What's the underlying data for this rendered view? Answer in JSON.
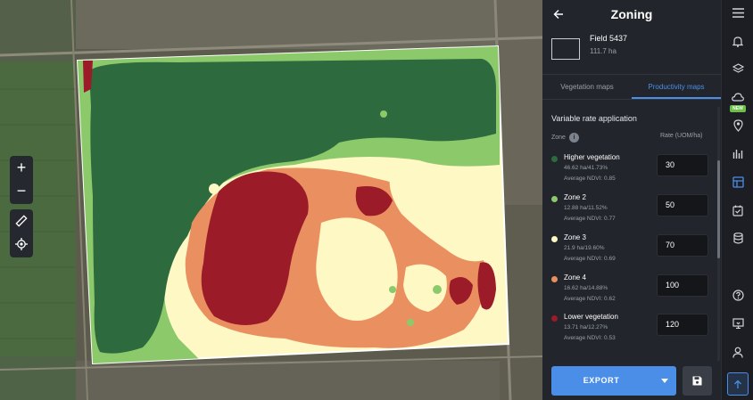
{
  "header": {
    "title": "Zoning"
  },
  "field": {
    "name": "Field 5437",
    "area": "111.7 ha"
  },
  "tabs": [
    {
      "label": "Vegetation maps",
      "active": false
    },
    {
      "label": "Productivity maps",
      "active": true
    }
  ],
  "vra": {
    "title": "Variable rate application",
    "zone_header": "Zone",
    "rate_header": "Rate (UOM/ha)",
    "zones": [
      {
        "name": "Higher vegetation",
        "area": "46.62 ha/41.73%",
        "ndvi": "Average NDVI: 0.85",
        "rate": "30",
        "color": "#2d6a3e"
      },
      {
        "name": "Zone 2",
        "area": "12.88 ha/11.52%",
        "ndvi": "Average NDVI: 0.77",
        "rate": "50",
        "color": "#8cc96b"
      },
      {
        "name": "Zone 3",
        "area": "21.9 ha/19.60%",
        "ndvi": "Average NDVI: 0.69",
        "rate": "70",
        "color": "#fdf8c4"
      },
      {
        "name": "Zone 4",
        "area": "16.62 ha/14.88%",
        "ndvi": "Average NDVI: 0.62",
        "rate": "100",
        "color": "#ea9060"
      },
      {
        "name": "Lower vegetation",
        "area": "13.71 ha/12.27%",
        "ndvi": "Average NDVI: 0.53",
        "rate": "120",
        "color": "#9c1b28"
      }
    ]
  },
  "actions": {
    "export_label": "EXPORT"
  },
  "rail": {
    "new_badge": "NEW"
  },
  "map_controls": {
    "zoom_in": "+",
    "zoom_out": "−"
  },
  "colors": {
    "accent": "#4b8ee8",
    "panel": "#22252b",
    "new_badge": "#6cc04a"
  }
}
